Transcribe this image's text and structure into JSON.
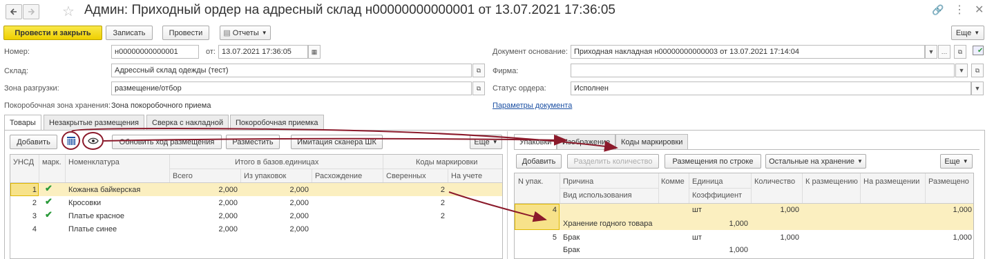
{
  "window": {
    "title": "Админ: Приходный ордер на адресный склад н00000000000001 от 13.07.2021 17:36:05"
  },
  "toolbar": {
    "post_close": "Провести и закрыть",
    "write": "Записать",
    "post": "Провести",
    "reports": "Отчеты",
    "more": "Еще"
  },
  "form": {
    "number_label": "Номер:",
    "number_value": "н00000000000001",
    "date_label": "от:",
    "date_value": "13.07.2021 17:36:05",
    "warehouse_label": "Склад:",
    "warehouse_value": "Адрессный склад одежды (тест)",
    "unload_label": "Зона разгрузки:",
    "unload_value": "размещение/отбор",
    "zone_label": "Покоробочная зона хранения:",
    "zone_value": "Зона покоробочного приема",
    "basis_label": "Документ основание:",
    "basis_value": "Приходная накладная н00000000000003 от 13.07.2021 17:14:04",
    "firm_label": "Фирма:",
    "firm_value": "",
    "status_label": "Статус ордера:",
    "status_value": "Исполнен",
    "params_link": "Параметры документа"
  },
  "tabs": [
    "Товары",
    "Незакрытые размещения",
    "Сверка с накладной",
    "Покоробочная приемка"
  ],
  "left_toolbar": {
    "add": "Добавить",
    "update": "Обновить ход размещения",
    "place": "Разместить",
    "scanner": "Имитация сканера ШК",
    "more": "Еще"
  },
  "left_table": {
    "headers": {
      "unsd": "УНСД",
      "mark": "марк.",
      "nom": "Номенклатура",
      "group_totals": "Итого в базов.единицах",
      "group_codes": "Коды маркировки",
      "total": "Всего",
      "from_pack": "Из упаковок",
      "diff": "Расхождение",
      "checked": "Сверенных",
      "on_account": "На учете"
    },
    "rows": [
      {
        "n": "1",
        "mark": "✔",
        "name": "Кожанка байкерская",
        "total": "2,000",
        "pack": "2,000",
        "diff": "",
        "checked": "2"
      },
      {
        "n": "2",
        "mark": "✔",
        "name": "Кросовки",
        "total": "2,000",
        "pack": "2,000",
        "diff": "",
        "checked": "2"
      },
      {
        "n": "3",
        "mark": "✔",
        "name": "Платье красное",
        "total": "2,000",
        "pack": "2,000",
        "diff": "",
        "checked": "2"
      },
      {
        "n": "4",
        "mark": "",
        "name": "Платье синее",
        "total": "2,000",
        "pack": "2,000",
        "diff": "",
        "checked": ""
      }
    ]
  },
  "right_tabs": [
    "Упаковки",
    "Изображение",
    "Коды маркировки"
  ],
  "right_toolbar": {
    "add": "Добавить",
    "split": "Разделить количество",
    "by_row": "Размещения по строке",
    "rest": "Остальные на хранение",
    "more": "Еще"
  },
  "right_table": {
    "headers": {
      "pack_no": "N упак.",
      "reason": "Причина",
      "usage": "Вид использования",
      "comment": "Комме",
      "unit": "Единица",
      "coef": "Коэффициент",
      "qty": "Количество",
      "to_place": "К размещению",
      "placing": "На размещении",
      "placed": "Размещено"
    },
    "rows": [
      {
        "n": "4",
        "reason": "",
        "usage": "Хранение годного товара",
        "unit": "шт",
        "coef": "1,000",
        "qty": "1,000",
        "placed": "1,000"
      },
      {
        "n": "5",
        "reason": "Брак",
        "usage": "Брак",
        "unit": "шт",
        "coef": "1,000",
        "qty": "1,000",
        "placed": "1,000"
      }
    ]
  },
  "colors": {
    "accent_yellow": "#f5dc1a",
    "selected_row": "#fbefc0",
    "arrow": "#8b1a2b",
    "link": "#1a4fa3"
  }
}
